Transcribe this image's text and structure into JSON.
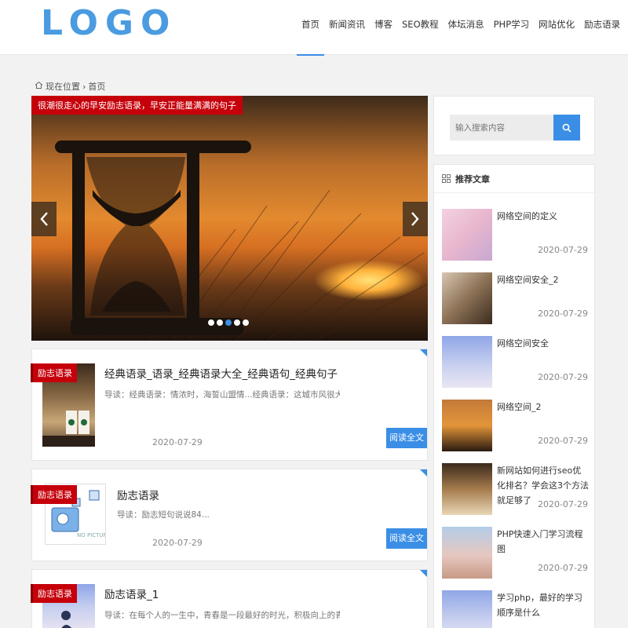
{
  "header": {
    "logo": "LOGO",
    "nav": [
      "首页",
      "新闻资讯",
      "博客",
      "SEO教程",
      "体坛消息",
      "PHP学习",
      "网站优化",
      "励志语录"
    ],
    "active_nav": "首页"
  },
  "breadcrumb": {
    "label": "现在位置",
    "separator": "›",
    "current": "首页"
  },
  "slider": {
    "caption": "很潮很走心的早安励志语录，早安正能量满满的句子",
    "dots_count": 5,
    "active_dot": 3
  },
  "articles": [
    {
      "category": "励志语录",
      "title": "经典语录_语录_经典语录大全_经典语句_经典句子",
      "summary": "导读：经典语录：情浓时，海誓山盟情...经典语录：这城市风很大，孤...",
      "date": "2020-07-29",
      "read_label": "阅读全文"
    },
    {
      "category": "励志语录",
      "title": "励志语录",
      "summary": "导读：励志短句说说84...",
      "date": "2020-07-29",
      "read_label": "阅读全文",
      "thumb_text_1": "NO PICTURE"
    },
    {
      "category": "励志语录",
      "title": "励志语录_1",
      "summary": "导读：在每个人的一生中，青春是一段最好的时光，积极向上的青春...",
      "date": "",
      "read_label": ""
    }
  ],
  "sidebar": {
    "search_placeholder": "输入搜索内容",
    "rec_title": "推荐文章",
    "rec_items": [
      {
        "title": "网络空间的定义",
        "date": "2020-07-29"
      },
      {
        "title": "网络空间安全_2",
        "date": "2020-07-29"
      },
      {
        "title": "网络空间安全",
        "date": "2020-07-29"
      },
      {
        "title": "网络空间_2",
        "date": "2020-07-29"
      },
      {
        "title": "新网站如何进行seo优化排名？学会这3个方法就足够了",
        "date": "2020-07-29"
      },
      {
        "title": "PHP快速入门学习流程图",
        "date": "2020-07-29"
      },
      {
        "title": "学习php，最好的学习顺序是什么",
        "date": ""
      }
    ]
  },
  "colors": {
    "accent": "#3a8ee6",
    "tag_red": "#c6000b",
    "logo_blue": "#4a9be0"
  }
}
